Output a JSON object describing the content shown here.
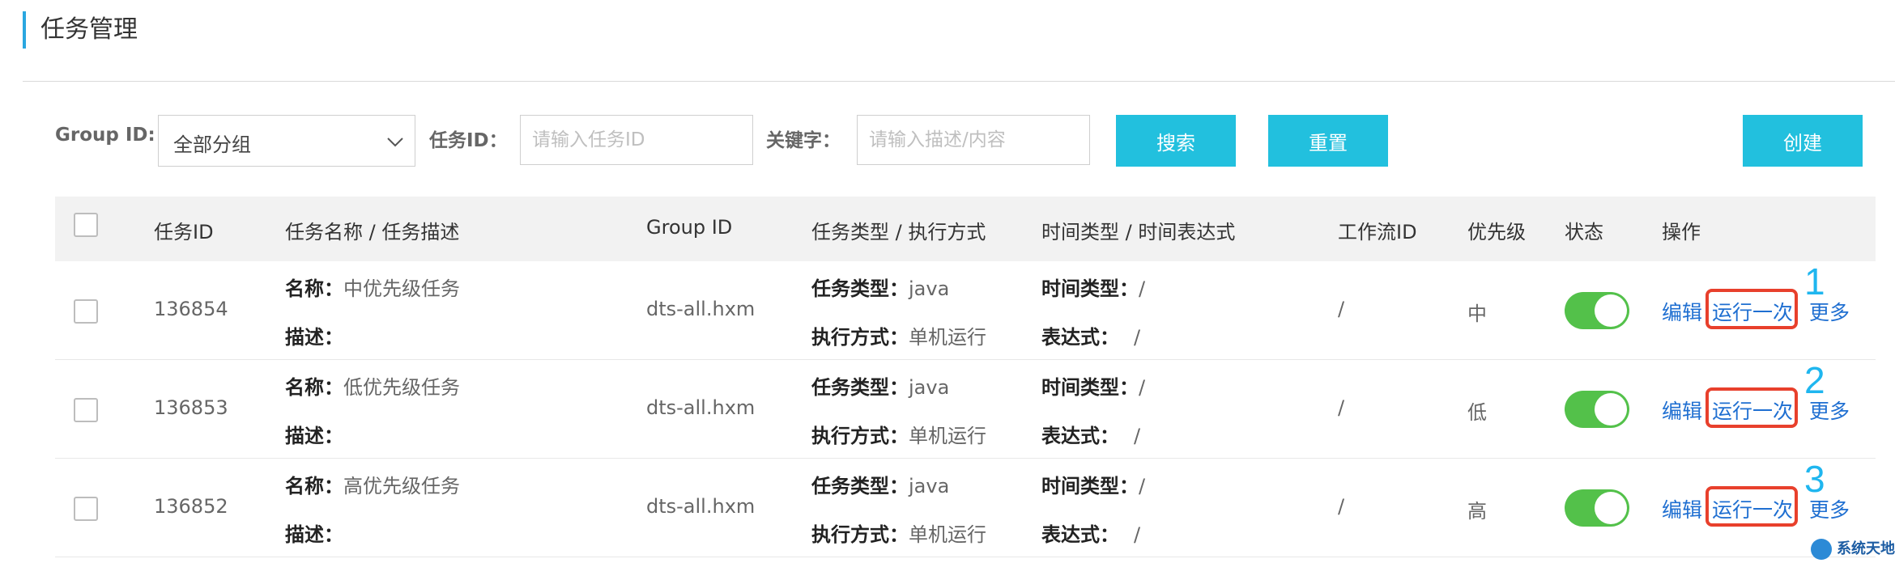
{
  "page": {
    "title": "任务管理"
  },
  "filters": {
    "group_label": "Group ID:",
    "group_value": "全部分组",
    "task_id_label": "任务ID：",
    "task_id_placeholder": "请输入任务ID",
    "keyword_label": "关键字：",
    "keyword_placeholder": "请输入描述/内容",
    "search_label": "搜索",
    "reset_label": "重置",
    "create_label": "创建"
  },
  "table": {
    "headers": {
      "id": "任务ID",
      "name": "任务名称 / 任务描述",
      "group": "Group ID",
      "type": "任务类型 / 执行方式",
      "time": "时间类型 / 时间表达式",
      "workflow": "工作流ID",
      "priority": "优先级",
      "status": "状态",
      "actions": "操作"
    },
    "key_labels": {
      "name": "名称：",
      "desc": "描述：",
      "task_type": "任务类型：",
      "exec_mode": "执行方式：",
      "time_type": "时间类型：",
      "expression": "表达式："
    },
    "action_labels": {
      "edit": "编辑",
      "run_once": "运行一次",
      "more": "更多"
    },
    "rows": [
      {
        "id": "136854",
        "name": "中优先级任务",
        "desc": "",
        "group": "dts-all.hxm",
        "task_type": "java",
        "exec_mode": "单机运行",
        "time_type": "/",
        "expression": "/",
        "workflow": "/",
        "priority": "中",
        "enabled": true,
        "annotation": "1"
      },
      {
        "id": "136853",
        "name": "低优先级任务",
        "desc": "",
        "group": "dts-all.hxm",
        "task_type": "java",
        "exec_mode": "单机运行",
        "time_type": "/",
        "expression": "/",
        "workflow": "/",
        "priority": "低",
        "enabled": true,
        "annotation": "2"
      },
      {
        "id": "136852",
        "name": "高优先级任务",
        "desc": "",
        "group": "dts-all.hxm",
        "task_type": "java",
        "exec_mode": "单机运行",
        "time_type": "/",
        "expression": "/",
        "workflow": "/",
        "priority": "高",
        "enabled": true,
        "annotation": "3"
      }
    ]
  },
  "watermark": {
    "text": "系统天地"
  },
  "colors": {
    "accent": "#22c0de",
    "link": "#1f6fd1",
    "toggle_on": "#53c14a",
    "highlight": "#e8402c",
    "annotation": "#1fb6ef"
  }
}
